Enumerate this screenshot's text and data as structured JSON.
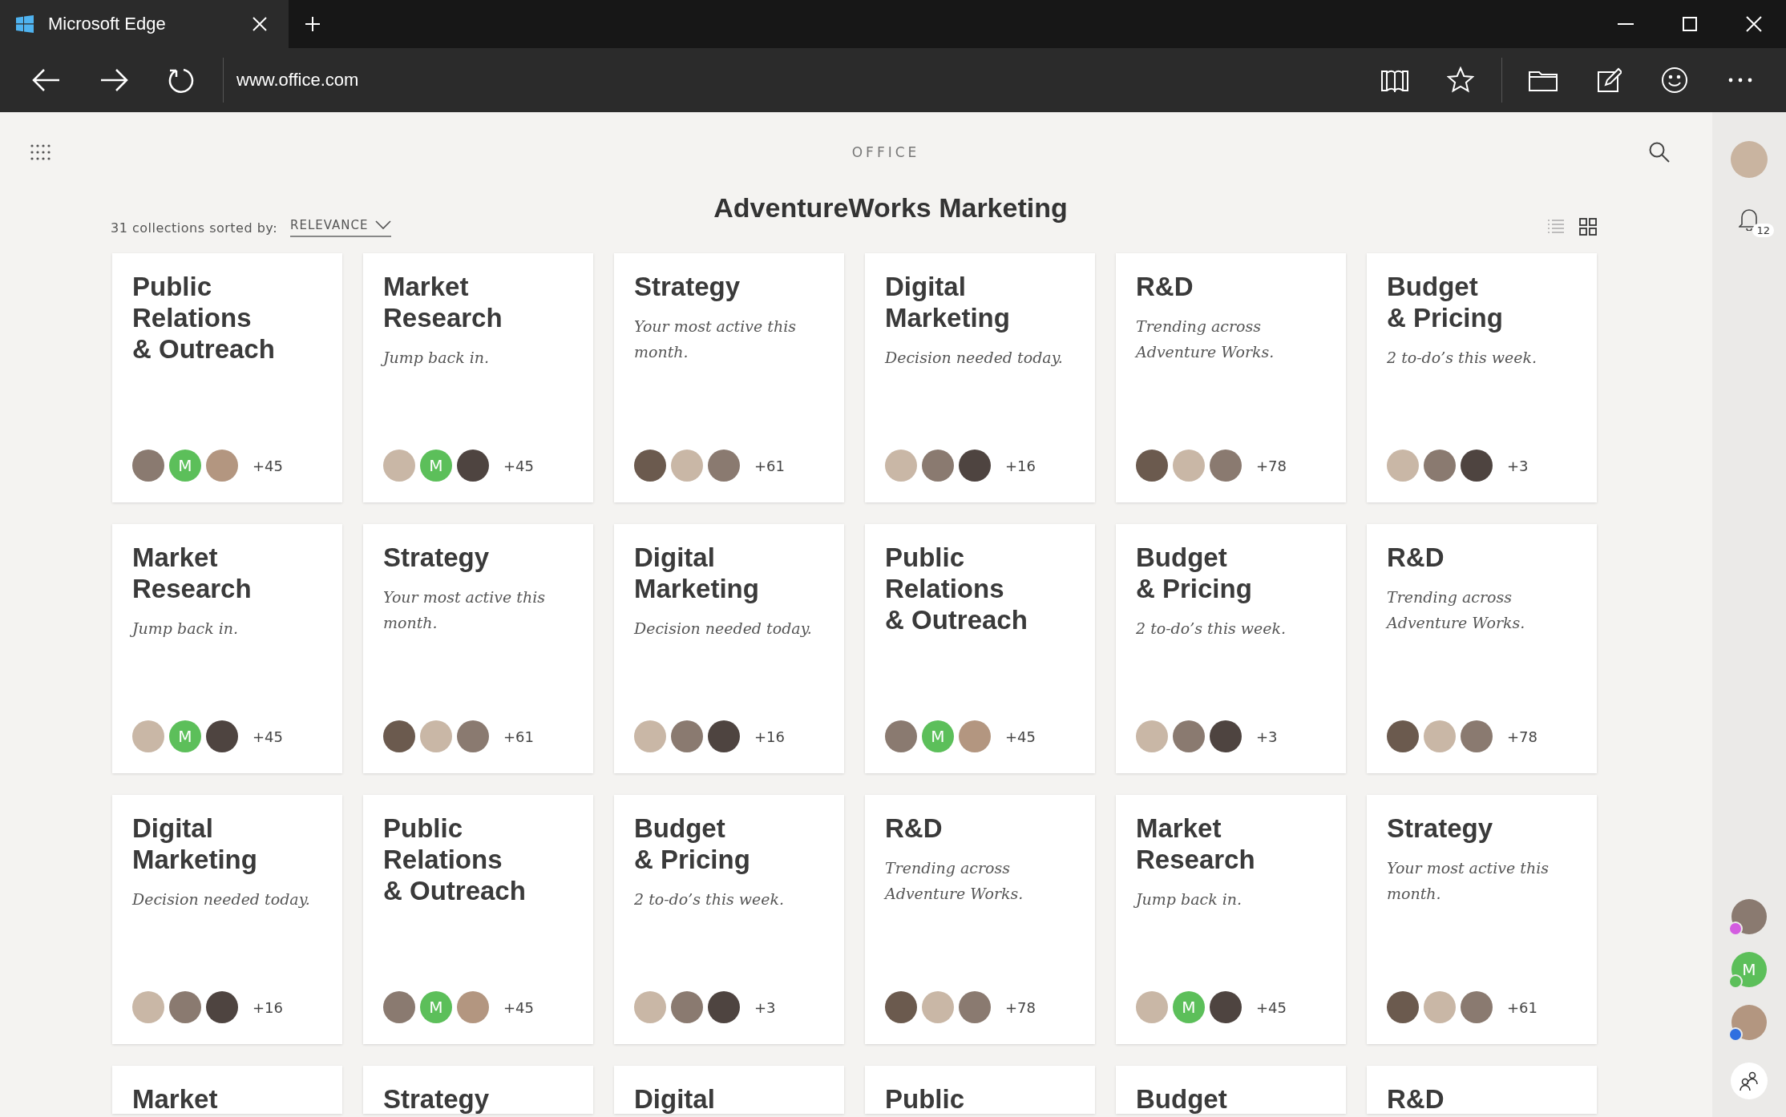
{
  "browser": {
    "tab": {
      "title": "Microsoft Edge"
    },
    "address": "www.office.com"
  },
  "header": {
    "brand": "OFFICE",
    "title": "AdventureWorks Marketing",
    "sort_label": "31 collections sorted by:",
    "sort_value": "RELEVANCE",
    "views": [
      {
        "kind": "list",
        "selected": false
      },
      {
        "kind": "grid",
        "selected": true
      }
    ]
  },
  "cards": [
    {
      "title_lines": [
        "Public",
        "Relations",
        "& Outreach"
      ],
      "avatars": [
        {
          "kind": "photo"
        },
        {
          "kind": "initial",
          "text": "M"
        },
        {
          "kind": "photo"
        }
      ],
      "count": "+45"
    },
    {
      "title_lines": [
        "Market",
        "Research"
      ],
      "subtitle": "Jump back in.",
      "avatars": [
        {
          "kind": "photo"
        },
        {
          "kind": "initial",
          "text": "M"
        },
        {
          "kind": "photo"
        }
      ],
      "count": "+45"
    },
    {
      "title_lines": [
        "Strategy"
      ],
      "subtitle": "Your most active this month.",
      "avatars": [
        {
          "kind": "photo"
        },
        {
          "kind": "photo"
        },
        {
          "kind": "photo"
        }
      ],
      "count": "+61"
    },
    {
      "title_lines": [
        "Digital",
        "Marketing"
      ],
      "subtitle": "Decision needed today.",
      "avatars": [
        {
          "kind": "photo"
        },
        {
          "kind": "photo"
        },
        {
          "kind": "photo"
        }
      ],
      "count": "+16"
    },
    {
      "title_lines": [
        "R&D"
      ],
      "subtitle": "Trending across Adventure Works.",
      "avatars": [
        {
          "kind": "photo"
        },
        {
          "kind": "photo"
        },
        {
          "kind": "photo"
        }
      ],
      "count": "+78"
    },
    {
      "title_lines": [
        "Budget",
        "& Pricing"
      ],
      "subtitle": "2 to-do’s this week.",
      "avatars": [
        {
          "kind": "photo"
        },
        {
          "kind": "photo"
        },
        {
          "kind": "photo"
        }
      ],
      "count": "+3"
    },
    {
      "title_lines": [
        "Market",
        "Research"
      ],
      "subtitle": "Jump back in.",
      "avatars": [
        {
          "kind": "photo"
        },
        {
          "kind": "initial",
          "text": "M"
        },
        {
          "kind": "photo"
        }
      ],
      "count": "+45"
    },
    {
      "title_lines": [
        "Strategy"
      ],
      "subtitle": "Your most active this month.",
      "avatars": [
        {
          "kind": "photo"
        },
        {
          "kind": "photo"
        },
        {
          "kind": "photo"
        }
      ],
      "count": "+61"
    },
    {
      "title_lines": [
        "Digital",
        "Marketing"
      ],
      "subtitle": "Decision needed today.",
      "avatars": [
        {
          "kind": "photo"
        },
        {
          "kind": "photo"
        },
        {
          "kind": "photo"
        }
      ],
      "count": "+16"
    },
    {
      "title_lines": [
        "Public",
        "Relations",
        "& Outreach"
      ],
      "avatars": [
        {
          "kind": "photo"
        },
        {
          "kind": "initial",
          "text": "M"
        },
        {
          "kind": "photo"
        }
      ],
      "count": "+45"
    },
    {
      "title_lines": [
        "Budget",
        "& Pricing"
      ],
      "subtitle": "2 to-do’s this week.",
      "avatars": [
        {
          "kind": "photo"
        },
        {
          "kind": "photo"
        },
        {
          "kind": "photo"
        }
      ],
      "count": "+3"
    },
    {
      "title_lines": [
        "R&D"
      ],
      "subtitle": "Trending across Adventure Works.",
      "avatars": [
        {
          "kind": "photo"
        },
        {
          "kind": "photo"
        },
        {
          "kind": "photo"
        }
      ],
      "count": "+78"
    },
    {
      "title_lines": [
        "Digital",
        "Marketing"
      ],
      "subtitle": "Decision needed today.",
      "avatars": [
        {
          "kind": "photo"
        },
        {
          "kind": "photo"
        },
        {
          "kind": "photo"
        }
      ],
      "count": "+16"
    },
    {
      "title_lines": [
        "Public",
        "Relations",
        "& Outreach"
      ],
      "avatars": [
        {
          "kind": "photo"
        },
        {
          "kind": "initial",
          "text": "M"
        },
        {
          "kind": "photo"
        }
      ],
      "count": "+45"
    },
    {
      "title_lines": [
        "Budget",
        "& Pricing"
      ],
      "subtitle": "2 to-do’s this week.",
      "avatars": [
        {
          "kind": "photo"
        },
        {
          "kind": "photo"
        },
        {
          "kind": "photo"
        }
      ],
      "count": "+3"
    },
    {
      "title_lines": [
        "R&D"
      ],
      "subtitle": "Trending across Adventure Works.",
      "avatars": [
        {
          "kind": "photo"
        },
        {
          "kind": "photo"
        },
        {
          "kind": "photo"
        }
      ],
      "count": "+78"
    },
    {
      "title_lines": [
        "Market",
        "Research"
      ],
      "subtitle": "Jump back in.",
      "avatars": [
        {
          "kind": "photo"
        },
        {
          "kind": "initial",
          "text": "M"
        },
        {
          "kind": "photo"
        }
      ],
      "count": "+45"
    },
    {
      "title_lines": [
        "Strategy"
      ],
      "subtitle": "Your most active this month.",
      "avatars": [
        {
          "kind": "photo"
        },
        {
          "kind": "photo"
        },
        {
          "kind": "photo"
        }
      ],
      "count": "+61"
    },
    {
      "title_lines": [
        "Market"
      ]
    },
    {
      "title_lines": [
        "Strategy"
      ]
    },
    {
      "title_lines": [
        "Digital"
      ]
    },
    {
      "title_lines": [
        "Public"
      ]
    },
    {
      "title_lines": [
        "Budget"
      ]
    },
    {
      "title_lines": [
        "R&D"
      ]
    }
  ],
  "sidebar": {
    "notifications": "12",
    "people": [
      {
        "kind": "photo",
        "color": "#d35de0"
      },
      {
        "kind": "initial",
        "text": "M",
        "color": "#5cbf5a"
      },
      {
        "kind": "photo",
        "color": "#2f6fe0"
      }
    ]
  }
}
